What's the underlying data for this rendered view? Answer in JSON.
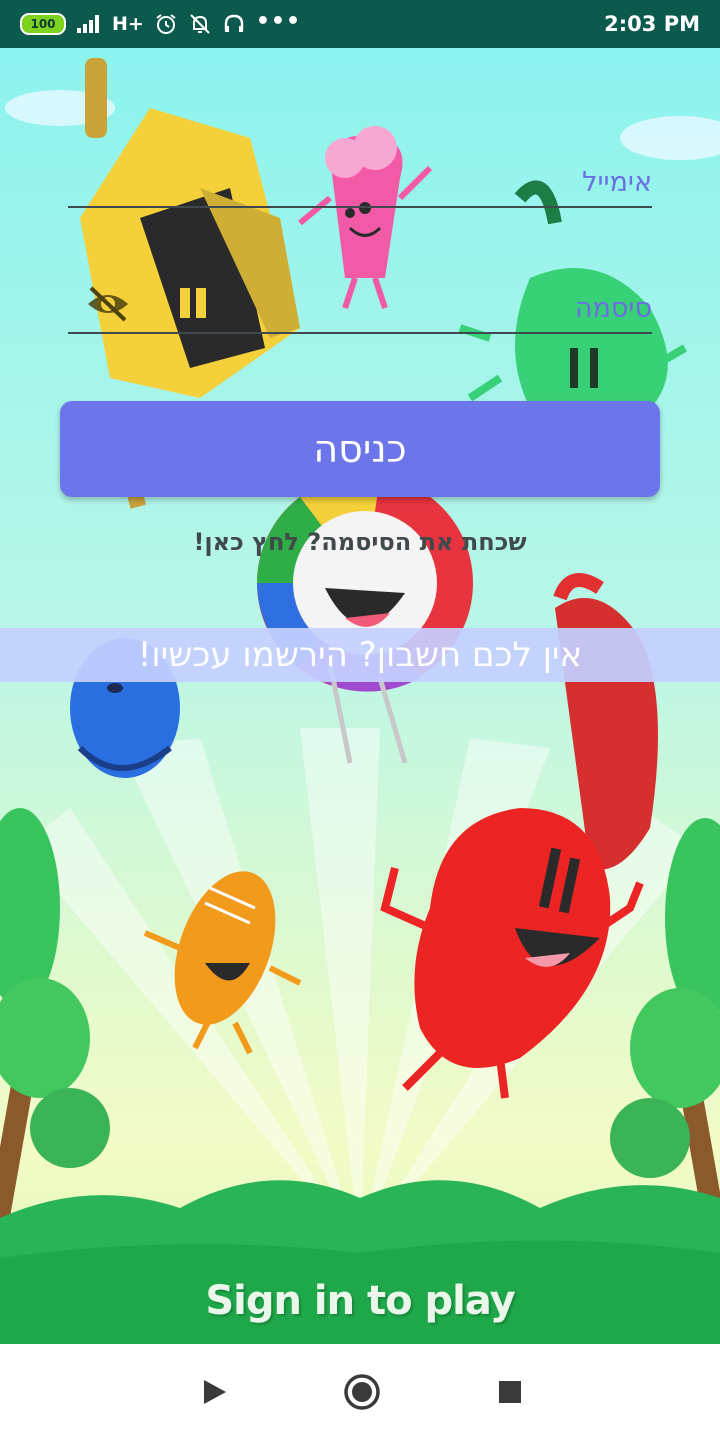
{
  "status_bar": {
    "battery": "100",
    "network": "H+",
    "more": "•••",
    "time": "2:03 PM",
    "background_color": "#0c5a4e"
  },
  "login_form": {
    "email_placeholder": "אימייל",
    "password_placeholder": "סיסמה",
    "login_button_label": "כניסה",
    "forgot_password_link": "שכחת את הסיסמה? לחץ כאן!",
    "register_banner": "אין לכם חשבון? הירשמו עכשיו!",
    "accent_color": "#6c76ea"
  },
  "background": {
    "caption": "Sign in to play"
  },
  "icons": {
    "password_toggle": "eye-off-icon",
    "nav_back": "back-triangle-icon",
    "nav_home": "home-circle-icon",
    "nav_recent": "recent-square-icon"
  }
}
